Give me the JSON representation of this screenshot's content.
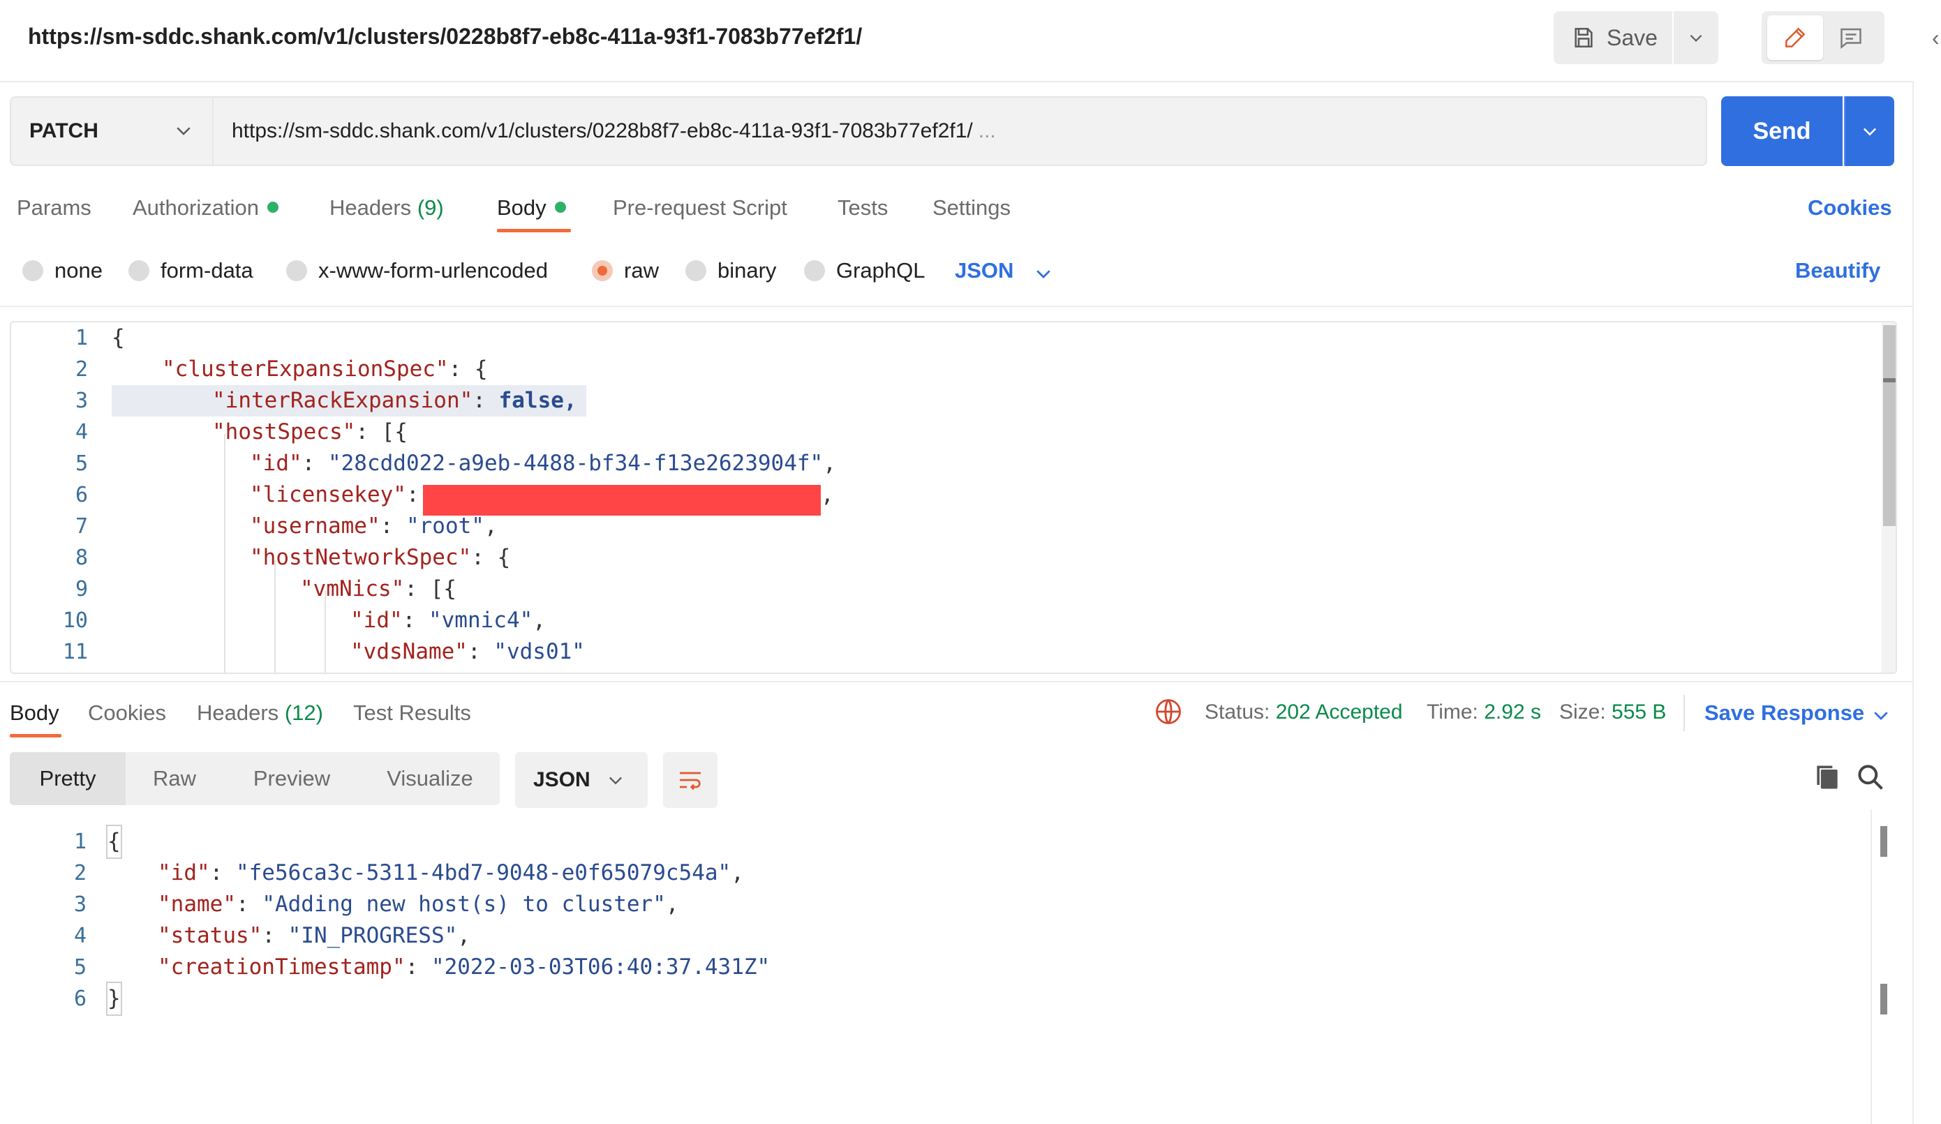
{
  "header": {
    "title_url": "https://sm-sddc.shank.com/v1/clusters/0228b8f7-eb8c-411a-93f1-7083b77ef2f1/",
    "save_label": "Save"
  },
  "request": {
    "method": "PATCH",
    "url": "https://sm-sddc.shank.com/v1/clusters/0228b8f7-eb8c-411a-93f1-7083b77ef2f1/",
    "url_ellipsis": "...",
    "send_label": "Send"
  },
  "request_tabs": {
    "params": "Params",
    "authorization": "Authorization",
    "headers": "Headers",
    "headers_count": "(9)",
    "body": "Body",
    "pre_request": "Pre-request Script",
    "tests": "Tests",
    "settings": "Settings",
    "cookies": "Cookies"
  },
  "body_types": {
    "none": "none",
    "form_data": "form-data",
    "urlencoded": "x-www-form-urlencoded",
    "raw": "raw",
    "binary": "binary",
    "graphql": "GraphQL",
    "format": "JSON",
    "beautify": "Beautify"
  },
  "request_body": {
    "line_numbers": [
      "1",
      "2",
      "3",
      "4",
      "5",
      "6",
      "7",
      "8",
      "9",
      "10",
      "11"
    ],
    "l1_brace": "{",
    "l2_key": "\"clusterExpansionSpec\"",
    "l2_rest": ": {",
    "l3_key": "\"interRackExpansion\"",
    "l3_colon": ": ",
    "l3_val": "false,",
    "l4_key": "\"hostSpecs\"",
    "l4_rest": ": [{",
    "l5_key": "\"id\"",
    "l5_colon": ": ",
    "l5_val": "\"28cdd022-a9eb-4488-bf34-f13e2623904f\"",
    "l5_end": ",",
    "l6_key": "\"licensekey\"",
    "l6_colon": ":",
    "l6_end": ",",
    "l7_key": "\"username\"",
    "l7_colon": ": ",
    "l7_val": "\"root\"",
    "l7_end": ",",
    "l8_key": "\"hostNetworkSpec\"",
    "l8_rest": ": {",
    "l9_key": "\"vmNics\"",
    "l9_rest": ": [{",
    "l10_key": "\"id\"",
    "l10_colon": ": ",
    "l10_val": "\"vmnic4\"",
    "l10_end": ",",
    "l11_key": "\"vdsName\"",
    "l11_colon": ": ",
    "l11_val": "\"vds01\""
  },
  "response_tabs": {
    "body": "Body",
    "cookies": "Cookies",
    "headers": "Headers",
    "headers_count": "(12)",
    "test_results": "Test Results"
  },
  "response_status": {
    "status_label": "Status:",
    "status_value": "202 Accepted",
    "time_label": "Time:",
    "time_value": "2.92 s",
    "size_label": "Size:",
    "size_value": "555 B",
    "save_response": "Save Response"
  },
  "response_view": {
    "pretty": "Pretty",
    "raw": "Raw",
    "preview": "Preview",
    "visualize": "Visualize",
    "format": "JSON"
  },
  "response_body": {
    "line_numbers": [
      "1",
      "2",
      "3",
      "4",
      "5",
      "6"
    ],
    "open_brace": "{",
    "close_brace": "}",
    "id_key": "\"id\"",
    "id_val": "\"fe56ca3c-5311-4bd7-9048-e0f65079c54a\"",
    "name_key": "\"name\"",
    "name_val": "\"Adding new host(s) to cluster\"",
    "status_key": "\"status\"",
    "status_val": "\"IN_PROGRESS\"",
    "ts_key": "\"creationTimestamp\"",
    "ts_val": "\"2022-03-03T06:40:37.431Z\""
  },
  "colors": {
    "accent_blue": "#2f6fe0",
    "active_tab_orange": "#f26b3a",
    "success_green": "#0a8a4a",
    "redaction_red": "#ff4545"
  },
  "icons": {
    "save": "save-icon",
    "edit": "pencil-icon",
    "comment": "comment-icon",
    "globe": "network-globe-icon",
    "copy": "copy-icon",
    "search": "search-icon",
    "wrap": "wrap-lines-icon"
  }
}
